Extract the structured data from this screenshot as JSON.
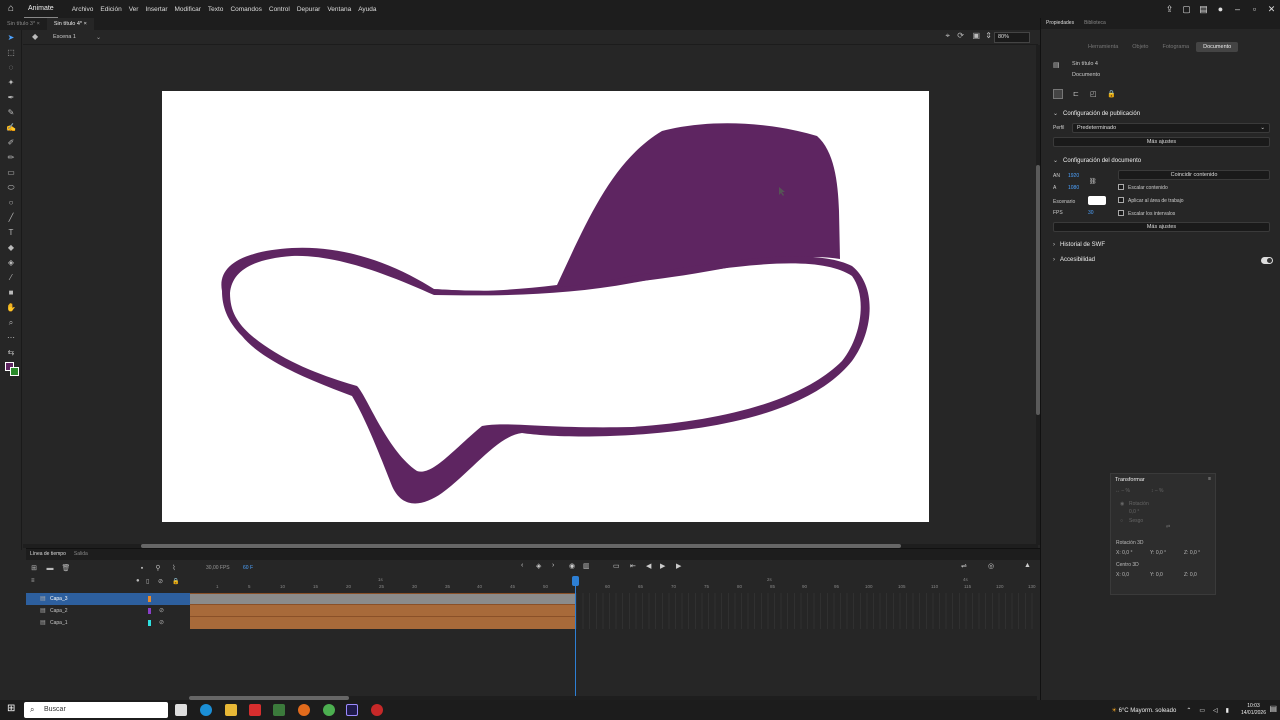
{
  "menubar": {
    "app": "Animate",
    "items": [
      "Archivo",
      "Edición",
      "Ver",
      "Insertar",
      "Modificar",
      "Texto",
      "Comandos",
      "Control",
      "Depurar",
      "Ventana",
      "Ayuda"
    ]
  },
  "doc_tabs": [
    {
      "label": "Sin título 3*"
    },
    {
      "label": "Sin título 4*"
    }
  ],
  "scene": {
    "label": "Escena 1",
    "zoom": "80%"
  },
  "stage": {
    "shape_color": "#5e2561",
    "bg": "#ffffff"
  },
  "timeline": {
    "tabs": [
      "Línea de tiempo",
      "Salida"
    ],
    "fps": "30,00",
    "fps_unit": "FPS",
    "frame": "60",
    "frame_unit": "F",
    "ruler": {
      "seconds": [
        "1s",
        "2s",
        "4s"
      ],
      "frames": [
        "1",
        "5",
        "10",
        "15",
        "20",
        "25",
        "30",
        "35",
        "40",
        "45",
        "50",
        "55",
        "60",
        "65",
        "70",
        "75",
        "80",
        "85",
        "90",
        "95",
        "100",
        "105",
        "110",
        "115",
        "120",
        "125",
        "130"
      ]
    },
    "layers": [
      {
        "name": "Capa_3",
        "color": "#e98b2c",
        "selected": true
      },
      {
        "name": "Capa_2",
        "color": "#8a3fc8",
        "selected": false
      },
      {
        "name": "Capa_1",
        "color": "#2ee0e0",
        "selected": false
      }
    ]
  },
  "panel": {
    "tabs": [
      "Propiedades",
      "Biblioteca"
    ],
    "subtabs": [
      "Herramienta",
      "Objeto",
      "Fotograma",
      "Documento"
    ],
    "doc_name": "Sin título 4",
    "doc_type": "Documento",
    "publish_section": "Configuración de publicación",
    "profile_label": "Perfil",
    "profile_value": "Predeterminado",
    "more_settings": "Más ajustes",
    "doc_section": "Configuración del documento",
    "an_label": "AN",
    "an_value": "1920",
    "a_label": "A",
    "a_value": "1080",
    "match_btn": "Coincidir contenido",
    "scale_content": "Escalar contenido",
    "stage_label": "Escenario",
    "apply_work": "Aplicar al área de trabajo",
    "fps_label": "FPS",
    "fps_value": "30",
    "scale_intervals": "Escalar los intervalos",
    "more_settings2": "Más ajustes",
    "swf_history": "Historial de SWF",
    "accessibility": "Accesibilidad"
  },
  "transform": {
    "title": "Transformar",
    "rotation": "Rotación",
    "rot_val": "0,0 °",
    "skew": "Sesgo",
    "rot3d": "Rotación 3D",
    "center3d": "Centro 3D",
    "x": "X:",
    "y": "Y:",
    "z": "Z:",
    "r3x": "0,0 °",
    "r3y": "0,0 °",
    "r3z": "0,0 °",
    "c3x": "0,0",
    "c3y": "0,0",
    "c3z": "0,0"
  },
  "taskbar": {
    "search": "Buscar",
    "weather": "6°C  Mayorm. soleado",
    "time": "10:03",
    "date": "14/01/2026"
  }
}
